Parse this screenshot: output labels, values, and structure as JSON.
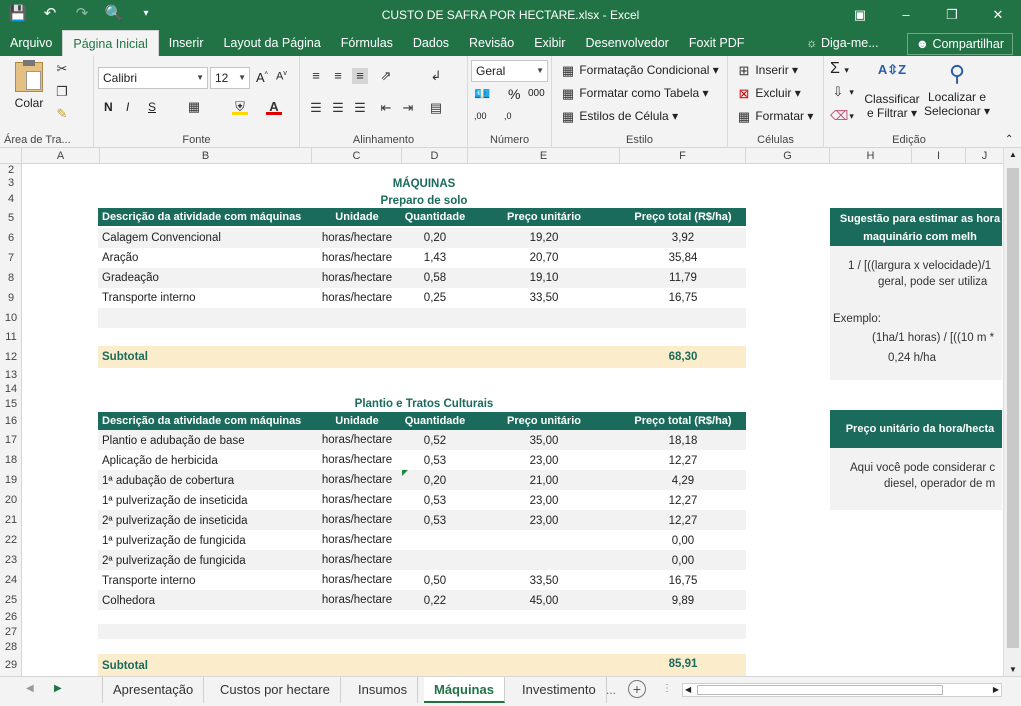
{
  "window": {
    "title": "CUSTO DE SAFRA POR HECTARE.xlsx - Excel",
    "qat_icons": [
      "save-icon",
      "undo-icon",
      "redo-icon",
      "print-preview-icon",
      "customize-icon"
    ]
  },
  "ribbon_tabs": [
    "Arquivo",
    "Página Inicial",
    "Inserir",
    "Layout da Página",
    "Fórmulas",
    "Dados",
    "Revisão",
    "Exibir",
    "Desenvolvedor",
    "Foxit PDF"
  ],
  "tell_me": "Diga-me...",
  "share_label": "Compartilhar",
  "ribbon": {
    "clipboard": {
      "paste": "Colar",
      "label": "Área de Tra..."
    },
    "font": {
      "name": "Calibri",
      "size": "12",
      "bold": "N",
      "italic": "I",
      "underline": "S",
      "label": "Fonte"
    },
    "alignment": {
      "label": "Alinhamento"
    },
    "number": {
      "format": "Geral",
      "percent": "%",
      "thousands": "000",
      "label": "Número"
    },
    "styles": {
      "conditional": "Formatação Condicional",
      "as_table": "Formatar como Tabela",
      "cell_styles": "Estilos de Célula",
      "label": "Estilo"
    },
    "cells": {
      "insert": "Inserir",
      "delete": "Excluir",
      "format": "Formatar",
      "label": "Células"
    },
    "editing": {
      "sort": "Classificar",
      "filter": "e Filtrar",
      "find": "Localizar e",
      "select": "Selecionar",
      "label": "Edição"
    }
  },
  "columns": [
    "A",
    "B",
    "C",
    "D",
    "E",
    "F",
    "G",
    "H",
    "I",
    "J"
  ],
  "rows": [
    "2",
    "3",
    "4",
    "5",
    "6",
    "7",
    "8",
    "9",
    "10",
    "11",
    "12",
    "13",
    "14",
    "15",
    "16",
    "17",
    "18",
    "19",
    "20",
    "21",
    "22",
    "23",
    "24",
    "25",
    "26",
    "27",
    "28",
    "29"
  ],
  "sheet": {
    "main_title": "MÁQUINAS",
    "section1": {
      "title": "Preparo de solo",
      "headers": [
        "Descrição da atividade com máquinas",
        "Unidade",
        "Quantidade",
        "Preço unitário",
        "Preço total (R$/ha)"
      ],
      "rows": [
        {
          "desc": "Calagem Convencional",
          "unit": "horas/hectare",
          "qty": "0,20",
          "price": "19,20",
          "total": "3,92"
        },
        {
          "desc": "Aração",
          "unit": "horas/hectare",
          "qty": "1,43",
          "price": "20,70",
          "total": "35,84"
        },
        {
          "desc": "Gradeação",
          "unit": "horas/hectare",
          "qty": "0,58",
          "price": "19,10",
          "total": "11,79"
        },
        {
          "desc": "Transporte interno",
          "unit": "horas/hectare",
          "qty": "0,25",
          "price": "33,50",
          "total": "16,75"
        }
      ],
      "subtotal_label": "Subtotal",
      "subtotal_value": "68,30"
    },
    "section2": {
      "title": "Plantio e Tratos Culturais",
      "headers": [
        "Descrição da atividade com máquinas",
        "Unidade",
        "Quantidade",
        "Preço unitário",
        "Preço total (R$/ha)"
      ],
      "rows": [
        {
          "desc": "Plantio e adubação de base",
          "unit": "horas/hectare",
          "qty": "0,52",
          "price": "35,00",
          "total": "18,18"
        },
        {
          "desc": "Aplicação de herbicida",
          "unit": "horas/hectare",
          "qty": "0,53",
          "price": "23,00",
          "total": "12,27"
        },
        {
          "desc": "1ª adubação de cobertura",
          "unit": "horas/hectare",
          "qty": "0,20",
          "price": "21,00",
          "total": "4,29"
        },
        {
          "desc": "1ª pulverização de inseticida",
          "unit": "horas/hectare",
          "qty": "0,53",
          "price": "23,00",
          "total": "12,27"
        },
        {
          "desc": "2ª pulverização de inseticida",
          "unit": "horas/hectare",
          "qty": "0,53",
          "price": "23,00",
          "total": "12,27"
        },
        {
          "desc": "1ª pulverização de fungicida",
          "unit": "horas/hectare",
          "qty": "",
          "price": "",
          "total": "0,00"
        },
        {
          "desc": "2ª pulverização de fungicida",
          "unit": "horas/hectare",
          "qty": "",
          "price": "",
          "total": "0,00"
        },
        {
          "desc": "Transporte interno",
          "unit": "horas/hectare",
          "qty": "0,50",
          "price": "33,50",
          "total": "16,75"
        },
        {
          "desc": "Colhedora",
          "unit": "horas/hectare",
          "qty": "0,22",
          "price": "45,00",
          "total": "9,89"
        }
      ],
      "subtotal_label": "Subtotal",
      "subtotal_value": "85,91"
    },
    "side1": {
      "head1": "Sugestão para estimar as hora",
      "head2": "maquinário com melh",
      "line1": "1 / [((largura x velocidade)/1",
      "line2": "geral, pode ser utiliza",
      "example_label": "Exemplo:",
      "example_formula": "(1ha/1 horas) / [((10 m *",
      "example_result": "0,24  h/ha"
    },
    "side2": {
      "head": "Preço unitário da hora/hecta",
      "line1": "Aqui você pode considerar c",
      "line2": "diesel, operador de m"
    }
  },
  "sheet_tabs": [
    "Apresentação",
    "Custos por hectare",
    "Insumos",
    "Máquinas",
    "Investimento"
  ],
  "active_sheet": "Máquinas"
}
